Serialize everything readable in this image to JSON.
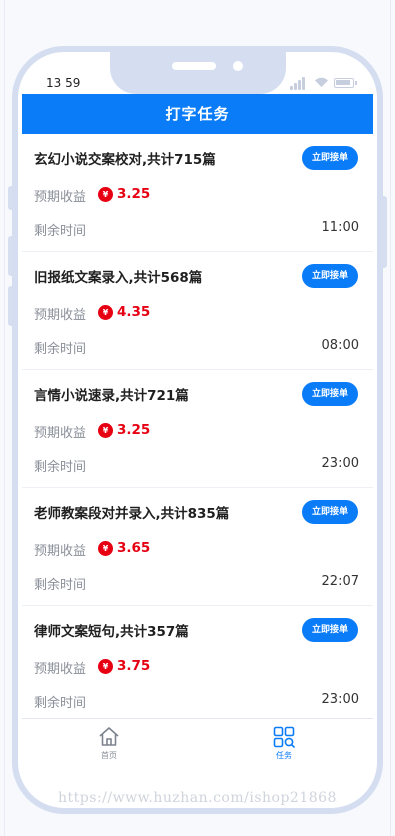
{
  "status_bar": {
    "time": "13 59"
  },
  "header": {
    "title": "打字任务"
  },
  "tasks": [
    {
      "title": "玄幻小说交案校对,共计715篇",
      "button": "立即接单",
      "income_label": "预期收益",
      "income_icon": "¥",
      "income": "3.25",
      "remain_label": "剩余时间",
      "remain": "11:00"
    },
    {
      "title": "旧报纸文案录入,共计568篇",
      "button": "立即接单",
      "income_label": "预期收益",
      "income_icon": "¥",
      "income": "4.35",
      "remain_label": "剩余时间",
      "remain": "08:00"
    },
    {
      "title": "言情小说速录,共计721篇",
      "button": "立即接单",
      "income_label": "预期收益",
      "income_icon": "¥",
      "income": "3.25",
      "remain_label": "剩余时间",
      "remain": "23:00"
    },
    {
      "title": "老师教案段对并录入,共计835篇",
      "button": "立即接单",
      "income_label": "预期收益",
      "income_icon": "¥",
      "income": "3.65",
      "remain_label": "剩余时间",
      "remain": "22:07"
    },
    {
      "title": "律师文案短句,共计357篇",
      "button": "立即接单",
      "income_label": "预期收益",
      "income_icon": "¥",
      "income": "3.75",
      "remain_label": "剩余时间",
      "remain": "23:00"
    }
  ],
  "tabbar": {
    "home": {
      "label": "首页",
      "icon": "home-icon"
    },
    "task": {
      "label": "任务",
      "icon": "grid-search-icon",
      "active": true
    }
  },
  "colors": {
    "accent": "#0a7cf8",
    "income": "#e60012",
    "frame": "#d5def0"
  },
  "watermark": "https://www.huzhan.com/ishop21868"
}
